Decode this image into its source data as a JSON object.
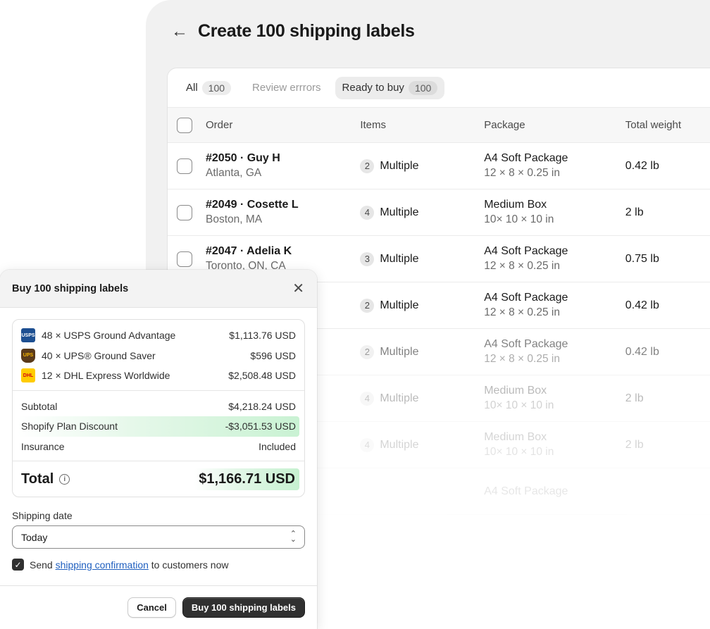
{
  "background": {
    "back_icon": "arrow-left-icon",
    "title": "Create 100 shipping labels",
    "tabs": [
      {
        "label": "All",
        "count": "100",
        "state": "default"
      },
      {
        "label": "Review errrors",
        "count": "",
        "state": "muted"
      },
      {
        "label": "Ready to buy",
        "count": "100",
        "state": "active"
      }
    ],
    "columns": {
      "order": "Order",
      "items": "Items",
      "package": "Package",
      "weight": "Total weight"
    },
    "rows": [
      {
        "order": "#2050 · Guy H",
        "location": "Atlanta, GA",
        "item_count": "2",
        "items": "Multiple",
        "package": "A4 Soft Package",
        "dims": "12 × 8 × 0.25 in",
        "weight": "0.42 lb"
      },
      {
        "order": "#2049 · Cosette L",
        "location": "Boston, MA",
        "item_count": "4",
        "items": "Multiple",
        "package": "Medium Box",
        "dims": "10× 10 × 10 in",
        "weight": "2 lb"
      },
      {
        "order": "#2047 · Adelia K",
        "location": "Toronto, ON, CA",
        "item_count": "3",
        "items": "Multiple",
        "package": "A4 Soft Package",
        "dims": "12 × 8 × 0.25 in",
        "weight": "0.75 lb"
      },
      {
        "order": "",
        "location": "",
        "item_count": "2",
        "items": "Multiple",
        "package": "A4 Soft Package",
        "dims": "12 × 8 × 0.25 in",
        "weight": "0.42 lb"
      },
      {
        "order": "",
        "location": "",
        "item_count": "2",
        "items": "Multiple",
        "package": "A4 Soft Package",
        "dims": "12 × 8 × 0.25 in",
        "weight": "0.42 lb"
      },
      {
        "order": "",
        "location": "",
        "item_count": "4",
        "items": "Multiple",
        "package": "Medium Box",
        "dims": "10× 10 × 10 in",
        "weight": "2 lb"
      },
      {
        "order": "",
        "location": "",
        "item_count": "4",
        "items": "Multiple",
        "package": "Medium Box",
        "dims": "10× 10 × 10 in",
        "weight": "2 lb"
      },
      {
        "order": "",
        "location": "",
        "item_count": "",
        "items": "",
        "package": "A4 Soft Package",
        "dims": "",
        "weight": ""
      }
    ]
  },
  "modal": {
    "title": "Buy 100 shipping labels",
    "close_icon": "close-icon",
    "carriers": [
      {
        "logo": "usps-logo",
        "logo_text": "USPS",
        "label": "48 × USPS Ground Advantage",
        "amount": "$1,113.76 USD"
      },
      {
        "logo": "ups-logo",
        "logo_text": "UPS",
        "label": "40 × UPS® Ground Saver",
        "amount": "$596 USD"
      },
      {
        "logo": "dhl-logo",
        "logo_text": "DHL",
        "label": "12 × DHL Express Worldwide",
        "amount": "$2,508.48 USD"
      }
    ],
    "subtotal_label": "Subtotal",
    "subtotal_value": "$4,218.24 USD",
    "discount_label": "Shopify Plan Discount",
    "discount_value": "-$3,051.53 USD",
    "insurance_label": "Insurance",
    "insurance_value": "Included",
    "total_label": "Total",
    "total_value": "$1,166.71 USD",
    "shipping_date_label": "Shipping date",
    "shipping_date_value": "Today",
    "confirm_prefix": "Send ",
    "confirm_link": "shipping confirmation",
    "confirm_suffix": " to customers now",
    "confirm_checked": true,
    "cancel_label": "Cancel",
    "buy_label": "Buy 100 shipping labels"
  },
  "colors": {
    "accent_green": "#c9f2d3",
    "primary_button": "#303030",
    "link": "#1f5fbf"
  }
}
